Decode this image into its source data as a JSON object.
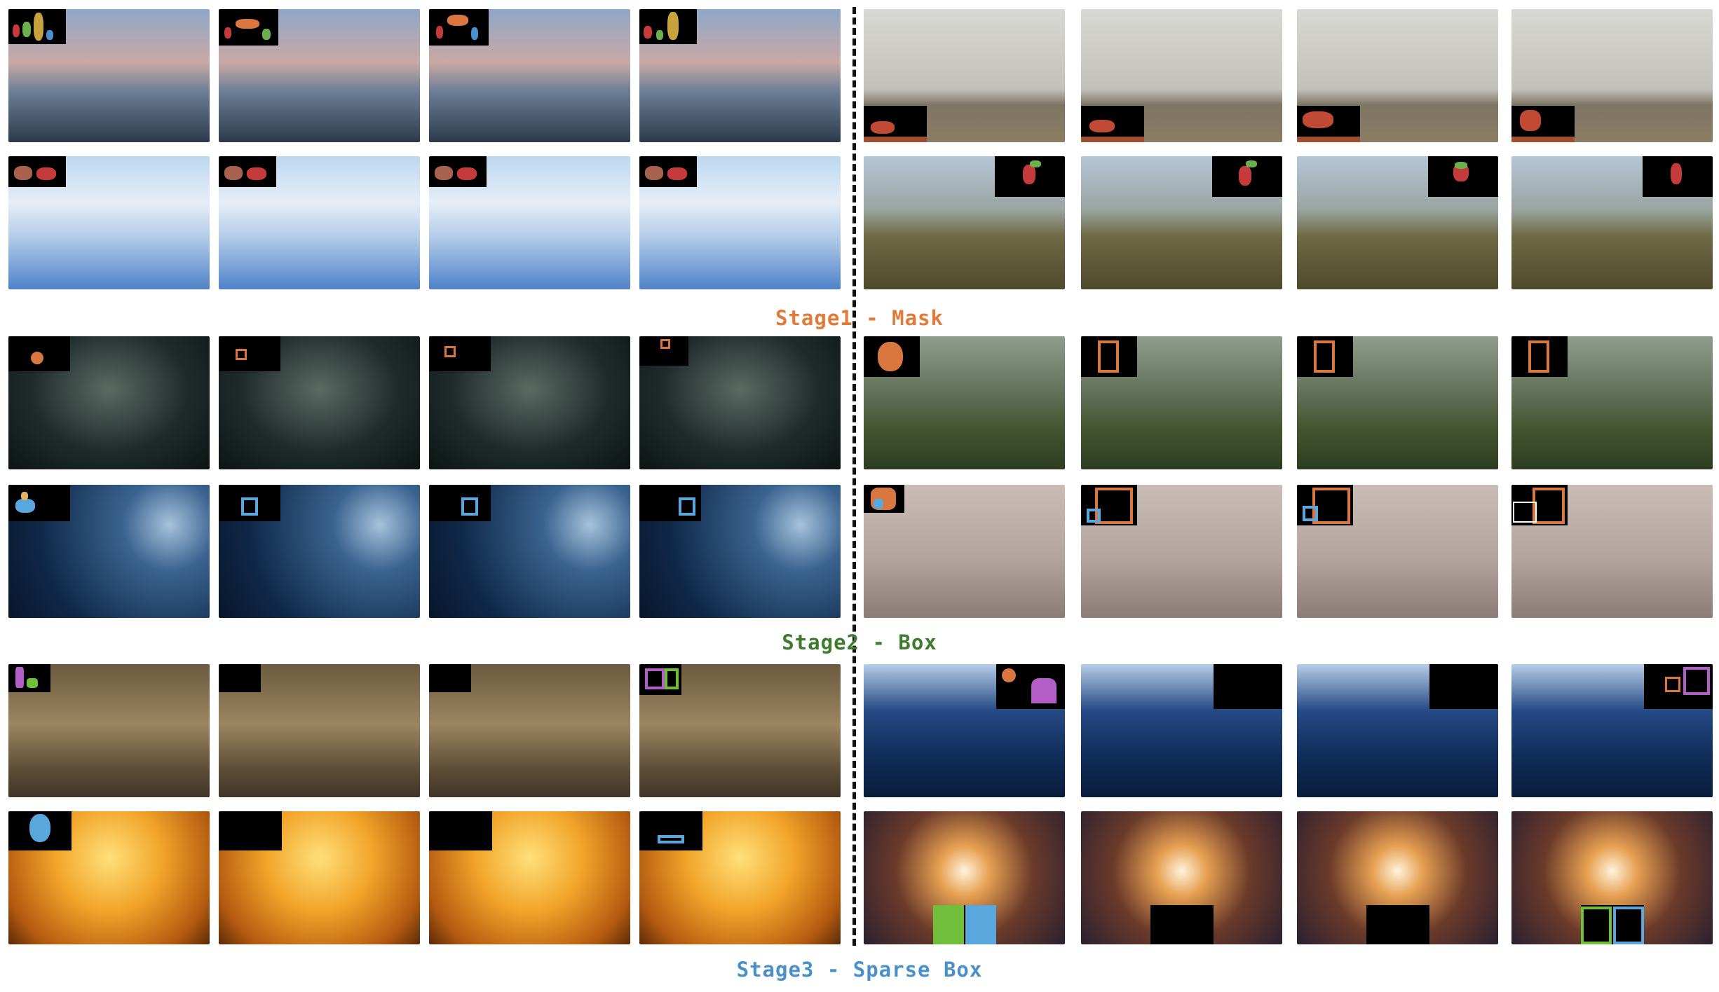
{
  "stages": [
    {
      "label": "Stage1 - Mask",
      "color": "#e07b39"
    },
    {
      "label": "Stage2 - Box",
      "color": "#3f7b2e"
    },
    {
      "label": "Stage3 - Sparse Box",
      "color": "#4a90c8"
    }
  ],
  "colors": {
    "mask_orange": "#d9773f",
    "box_blue": "#5aa7dd",
    "box_purple": "#b35ec7",
    "box_green": "#6fbf3a",
    "divider": "#111111"
  },
  "icons": [
    "mask-silhouette-icon",
    "bounding-box-icon"
  ]
}
